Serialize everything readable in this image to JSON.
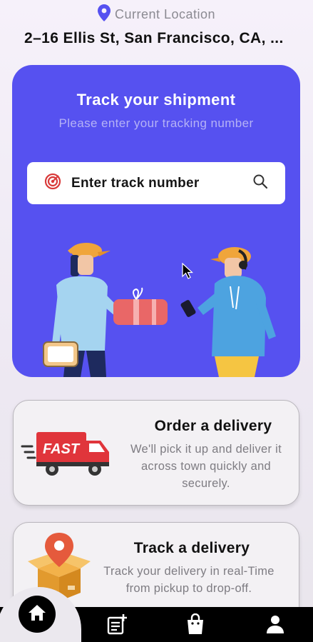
{
  "header": {
    "location_label": "Current Location",
    "address": "2–16 Ellis St, San Francisco, CA, ..."
  },
  "hero": {
    "title": "Track your shipment",
    "subtitle": "Please enter your tracking number",
    "search": {
      "placeholder": "Enter track number",
      "left_icon": "radar-target-icon",
      "right_icon": "search-icon"
    }
  },
  "cards": [
    {
      "title": "Order a delivery",
      "description": "We'll pick it up and deliver it across town quickly and securely.",
      "icon": "fast-truck-icon",
      "badge": "FAST"
    },
    {
      "title": "Track a delivery",
      "description": "Track your delivery in real-Time from pickup to drop-off.",
      "icon": "box-pin-icon"
    }
  ],
  "nav": {
    "items": [
      "home-icon",
      "order-add-icon",
      "shopping-bag-icon",
      "profile-icon"
    ],
    "active": "home-icon"
  },
  "colors": {
    "accent": "#5651f0",
    "subtitle": "#b5b2f6",
    "location_pin": "#5651f0",
    "target_red": "#d93a3a",
    "nav_bg": "#000000"
  }
}
